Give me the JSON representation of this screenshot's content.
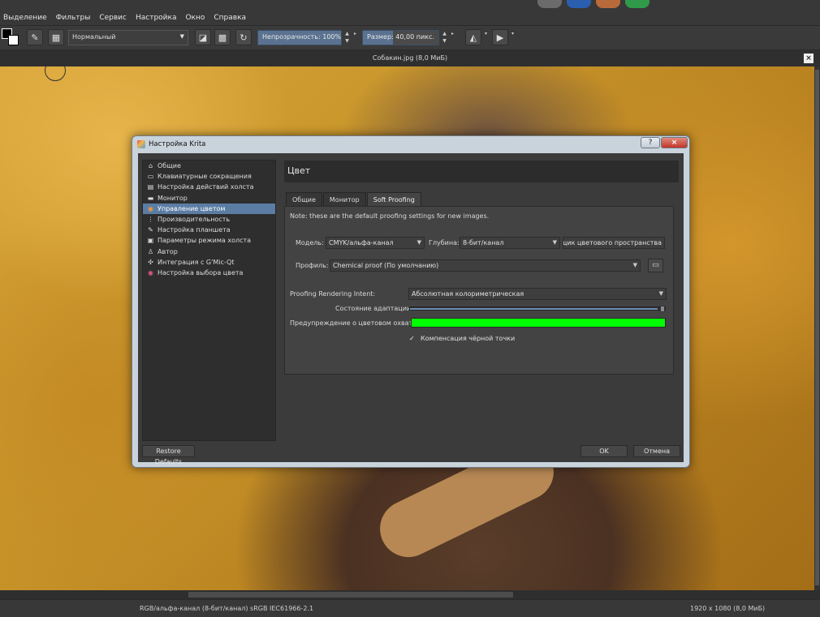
{
  "menubar": {
    "items": [
      {
        "label": "Выделение"
      },
      {
        "label": "Фильтры"
      },
      {
        "label": "Сервис"
      },
      {
        "label": "Настройка"
      },
      {
        "label": "Окно"
      },
      {
        "label": "Справка"
      }
    ]
  },
  "toolbar": {
    "blend_mode": "Нормальный",
    "opacity_label": "Непрозрачность:",
    "opacity_value": "100%",
    "size_label": "Размер:",
    "size_value": "40,00 пикс."
  },
  "document": {
    "title": "Собакин.jpg (8,0 МиБ)"
  },
  "statusbar": {
    "colorspace": "RGB/альфа-канал (8-бит/канал)  sRGB IEC61966-2.1",
    "image_size": "1920 x 1080 (8,0 МиБ)"
  },
  "dialog": {
    "title": "Настройка Krita",
    "help_label": "?",
    "close_label": "×",
    "nav": [
      {
        "label": "Общие",
        "icon": "home-icon"
      },
      {
        "label": "Клавиатурные сокращения",
        "icon": "keyboard-icon"
      },
      {
        "label": "Настройка действий холста",
        "icon": "canvas-input-icon"
      },
      {
        "label": "Монитор",
        "icon": "monitor-icon"
      },
      {
        "label": "Управление цветом",
        "icon": "color-wheel-icon"
      },
      {
        "label": "Производительность",
        "icon": "performance-icon"
      },
      {
        "label": "Настройка планшета",
        "icon": "tablet-pen-icon"
      },
      {
        "label": "Параметры режима холста",
        "icon": "canvas-mode-icon"
      },
      {
        "label": "Автор",
        "icon": "author-icon"
      },
      {
        "label": "Интеграция с G'Mic-Qt",
        "icon": "gmic-icon"
      },
      {
        "label": "Настройка выбора цвета",
        "icon": "color-selector-icon"
      }
    ],
    "selected_nav": "Управление цветом",
    "page_title": "Цвет",
    "tabs": [
      {
        "label": "Общие"
      },
      {
        "label": "Монитор"
      },
      {
        "label": "Soft Proofing"
      }
    ],
    "active_tab": "Soft Proofing",
    "soft_proofing": {
      "note": "Note: these are the default proofing settings for new images.",
      "model_label": "Модель:",
      "model_value": "CMYK/альфа-канал",
      "depth_label": "Глубина:",
      "depth_value": "8-бит/канал",
      "engine_value": "Проверщик цветового пространства",
      "profile_label": "Профиль:",
      "profile_value": "Chemical proof (По умолчанию)",
      "intent_label": "Proofing Rendering Intent:",
      "intent_value": "Абсолютная колориметрическая",
      "adaptation_label": "Состояние адаптации:",
      "adaptation_level": 0.97,
      "gamut_warning_label": "Предупреждение о цветовом охвате:",
      "gamut_warning_color": "#00ff00",
      "blackpoint_label": "Компенсация чёрной точки",
      "blackpoint_checked": true
    },
    "buttons": {
      "restore_defaults": "Restore Defaults",
      "ok": "OK",
      "cancel": "Отмена"
    }
  },
  "colors": {
    "accent": "#5b7da4",
    "dialog_frame": "#c9d3dc",
    "panel_bg": "#3b3b3b"
  }
}
